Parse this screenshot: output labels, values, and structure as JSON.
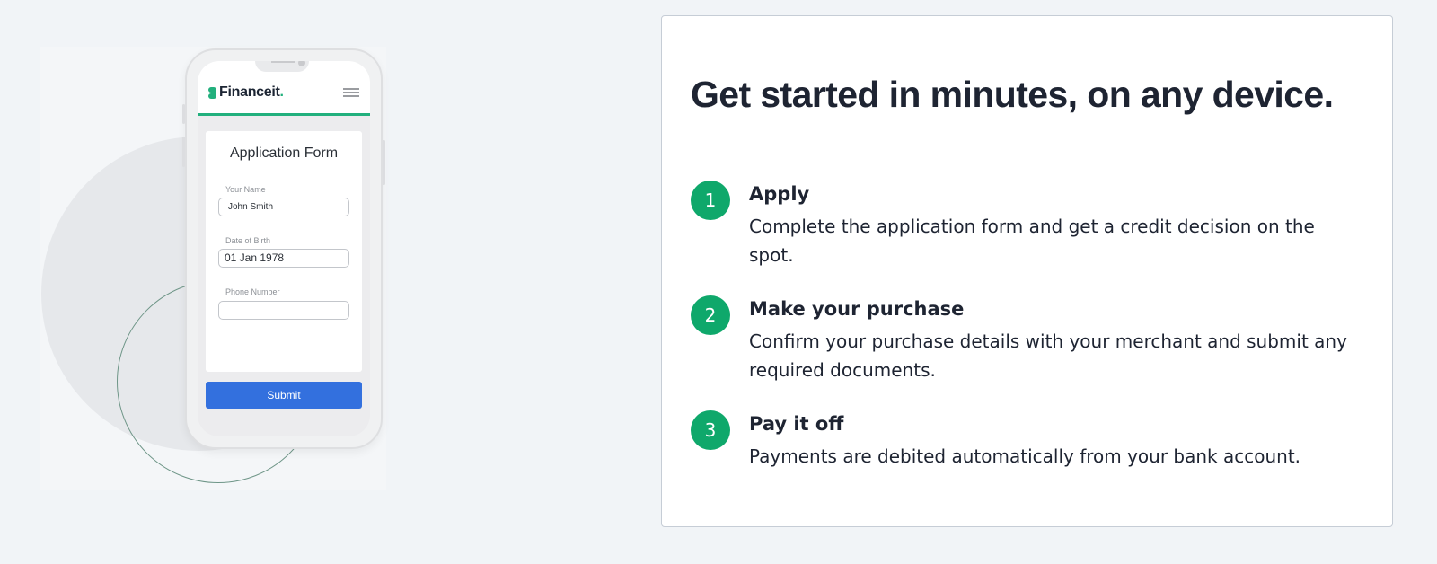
{
  "phone": {
    "brand_name": "Financeit",
    "brand_dot": ".",
    "form_title": "Application Form",
    "fields": [
      {
        "label": "Your Name",
        "value": "John Smith"
      },
      {
        "label": "Date of Birth",
        "value": "01 Jan 1978"
      },
      {
        "label": "Phone Number",
        "value": ""
      }
    ],
    "submit_label": "Submit"
  },
  "card": {
    "headline": "Get started in minutes, on any device.",
    "steps": [
      {
        "number": "1",
        "title": "Apply",
        "description": "Complete the application form and get a credit decision on the spot."
      },
      {
        "number": "2",
        "title": "Make your purchase",
        "description": "Confirm your purchase details with your merchant and submit any required documents."
      },
      {
        "number": "3",
        "title": "Pay it off",
        "description": "Payments are debited automatically from your bank account."
      }
    ]
  },
  "colors": {
    "brand_green": "#22b07d",
    "step_green": "#0fa86b",
    "submit_blue": "#3370de",
    "page_bg": "#f1f4f7"
  }
}
